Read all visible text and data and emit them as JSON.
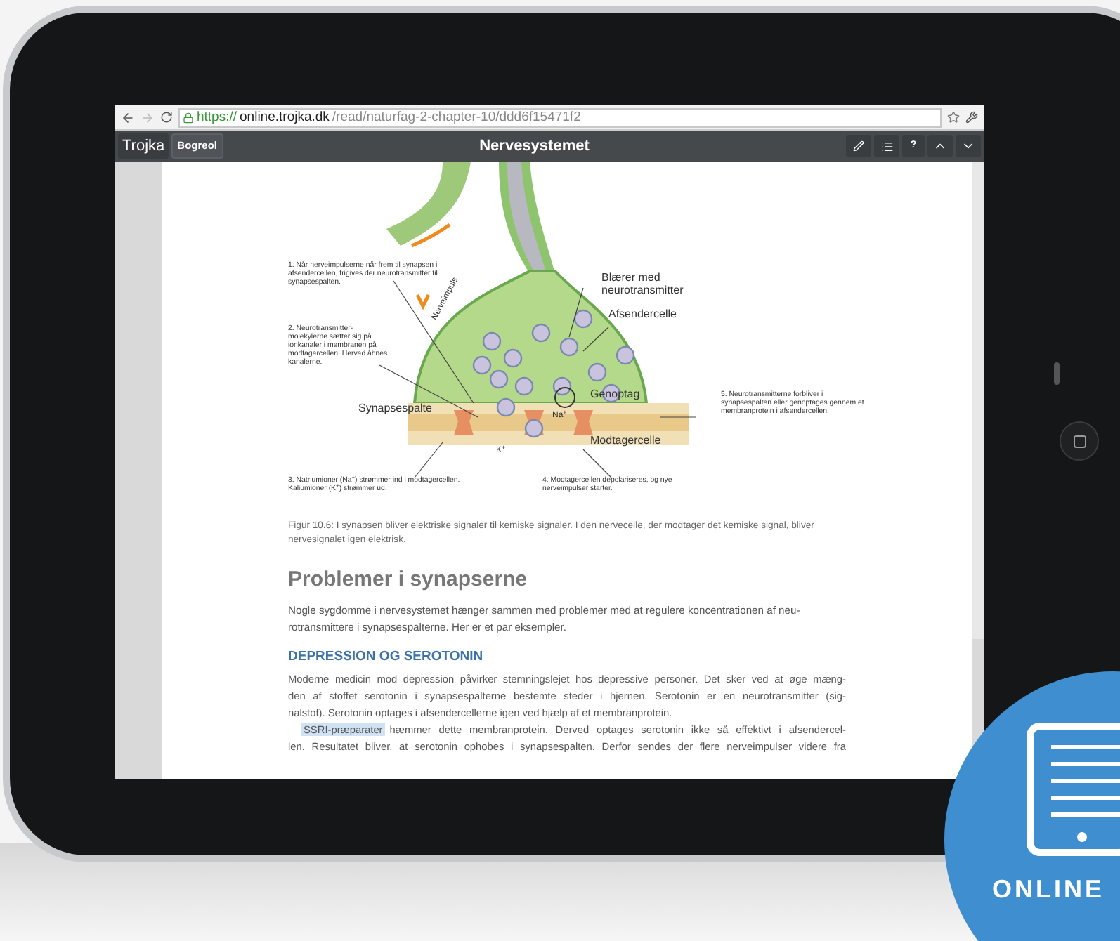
{
  "browser": {
    "url": {
      "scheme": "https://",
      "host": "online.trojka.dk",
      "path": "/read/naturfag-2-chapter-10/ddd6f15471f2"
    }
  },
  "toolbar": {
    "tabs": [
      {
        "label": "Trojka",
        "selected": true
      },
      {
        "label": "Bogreol",
        "selected": false
      }
    ],
    "title": "Nervesystemet",
    "help": "?"
  },
  "figure": {
    "annotations": [
      {
        "text": "1. Når nerveimpulserne når frem til synapsen i afsendercellen, frigives der neurotransmitter til synapsespalten."
      },
      {
        "text": "2. Neurotransmitter-molekylerne sætter sig på ionkanaler i membranen på modtagercellen. Herved åbnes kanalerne."
      },
      {
        "text": "5. Neurotransmitterne forbliver i synapsespalten eller genoptages gennem et membranprotein i afsendercellen."
      },
      {
        "text": "3. Natriumioner (Na$^{+}$) strømmer ind i modtagercellen. Kaliumioner (K$^{+}$) strømmer ud."
      },
      {
        "text": "4. Modtagercellen depolariseres, og nye nerveimpulser starter."
      }
    ],
    "labels": [
      {
        "text": "Blærer med neurotransmitter"
      },
      {
        "text": "Afsendercelle"
      },
      {
        "text": "Nerveimpuls"
      },
      {
        "text": "Synapsespalte"
      },
      {
        "text": "Genoptag"
      },
      {
        "text": "Na$^{+}$"
      },
      {
        "text": "K$^{+}$"
      },
      {
        "text": "Modtagercelle"
      }
    ],
    "caption": "Figur 10.6: I synapsen bliver elektriske signaler til kemiske signaler. I den nervecelle, der modtager det kemiske signal, bliver nervesignalet igen elektrisk."
  },
  "heading": "Problemer i synapserne",
  "intro": "Nogle sygdomme i nervesystemet hænger sammen med problemer med at regulere koncentrationen af neu-rotransmittere i synapsespalterne. Her er et par eksempler.",
  "subheading": "DEPRESSION OG SEROTONIN",
  "paragraph_1": {
    "lines": [
      "Moderne medicin mod depression påvirker stemningslejet hos depressive personer. Det sker ved at øge mæng-",
      "den af stoffet serotonin i synapsespalterne bestemte steder i hjernen. Serotonin er en neurotransmitter (sig-",
      "nalstof). Serotonin optages i afsendercellerne igen ved hjælp af et membranprotein."
    ]
  },
  "paragraph_2": {
    "highlighted": "SSRI-præparater",
    "lines": [
      "hæmmer dette membranprotein. Derved optages serotonin ikke så effektivt i afsendercel-",
      "len. Resultatet bliver, at serotonin ophobes i synapsespalten. Derfor sendes der flere nerveimpulser videre fra"
    ]
  },
  "badge": {
    "label": "ONLINE"
  }
}
